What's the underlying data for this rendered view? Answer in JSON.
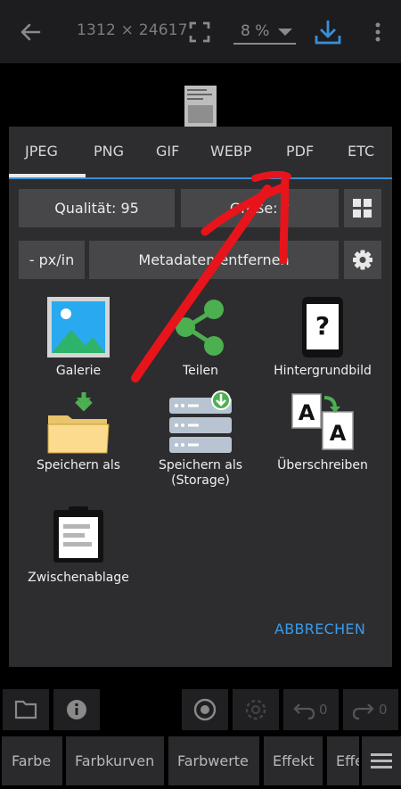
{
  "appbar": {
    "dimensions": "1312 × 24617",
    "zoom": "8 %",
    "icons": [
      "back-arrow-icon",
      "fullscreen-icon",
      "download-icon",
      "more-vert-icon"
    ]
  },
  "dialog": {
    "tabs": [
      "JPEG",
      "PNG",
      "GIF",
      "WEBP",
      "PDF",
      "ETC"
    ],
    "selected_tab": "JPEG",
    "quality_label": "Qualität: 95",
    "size_label": "Größe: ?",
    "ppi_label": "- px/in",
    "metadata_label": "Metadaten entfernen",
    "actions": [
      {
        "label": "Galerie",
        "icon": "gallery-icon"
      },
      {
        "label": "Teilen",
        "icon": "share-icon"
      },
      {
        "label": "Hintergrundbild",
        "icon": "wallpaper-phone-icon"
      },
      {
        "label": "Speichern als",
        "icon": "folder-download-icon"
      },
      {
        "label": "Speichern als (Storage)",
        "icon": "storage-download-icon"
      },
      {
        "label": "Überschreiben",
        "icon": "overwrite-icon"
      },
      {
        "label": "Zwischenablage",
        "icon": "clipboard-icon"
      }
    ],
    "cancel_label": "ABBRECHEN"
  },
  "toolbar": {
    "undo_count": "0",
    "redo_count": "0"
  },
  "bottom_menu": [
    "Farbe",
    "Farbkurven",
    "Farbwerte",
    "Effekt",
    "Effe"
  ],
  "colors": {
    "accent": "#3a9be8",
    "annotation": "#e8141b"
  }
}
